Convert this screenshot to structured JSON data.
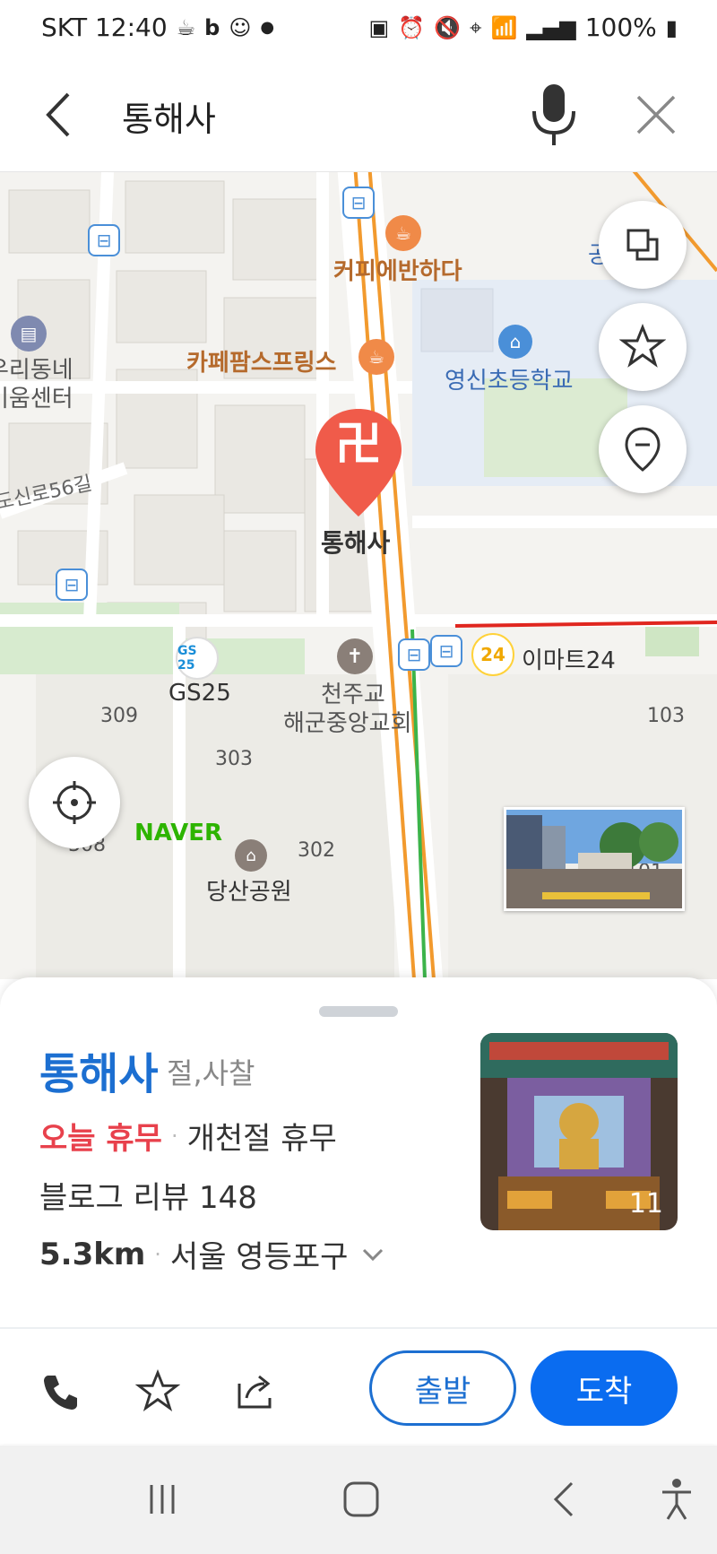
{
  "status_bar": {
    "carrier_time": "SKT 12:40",
    "left_icons": [
      "coffee-icon",
      "b-app-icon",
      "chat-icon",
      "dot-icon"
    ],
    "right_icons": [
      "nfc-icon",
      "alarm-icon",
      "mute-icon",
      "location-icon",
      "wifi-icon",
      "signal-icon"
    ],
    "battery": "100%"
  },
  "search": {
    "query": "통해사"
  },
  "map": {
    "labels": {
      "cafe1": "커피에반하다",
      "cafe2": "카페팜스프링스",
      "school": "영신초등학교",
      "community1": "우리동네",
      "community2": "키움센터",
      "road": "도신로56길",
      "gs25": "GS25",
      "gs25_logo": "GS 25",
      "church1": "천주교",
      "church2": "해군중앙교회",
      "emart": "이마트24",
      "emart_logo": "24",
      "apt309": "309",
      "apt303": "303",
      "apt302": "302",
      "apt308": "308",
      "apt103": "103",
      "apt101": "101",
      "park_partial": "당산공원",
      "gong": "공",
      "naver": "NAVER",
      "pin": "통해사",
      "pin_symbol": "卍"
    }
  },
  "place": {
    "name": "통해사",
    "category": "절,사찰",
    "status_closed": "오늘 휴무",
    "holiday_note": "개천절 휴무",
    "reviews": "블로그 리뷰 148",
    "distance": "5.3km",
    "district": "서울 영등포구",
    "photo_count": "11"
  },
  "actions": {
    "start": "출발",
    "arrive": "도착"
  },
  "colors": {
    "accent": "#1c6fd1",
    "primary_button": "#0a6cf0",
    "closed": "#e8414c",
    "pin": "#f05b4a",
    "road_orange": "#f29a2e",
    "subway_green": "#3cb44a"
  }
}
